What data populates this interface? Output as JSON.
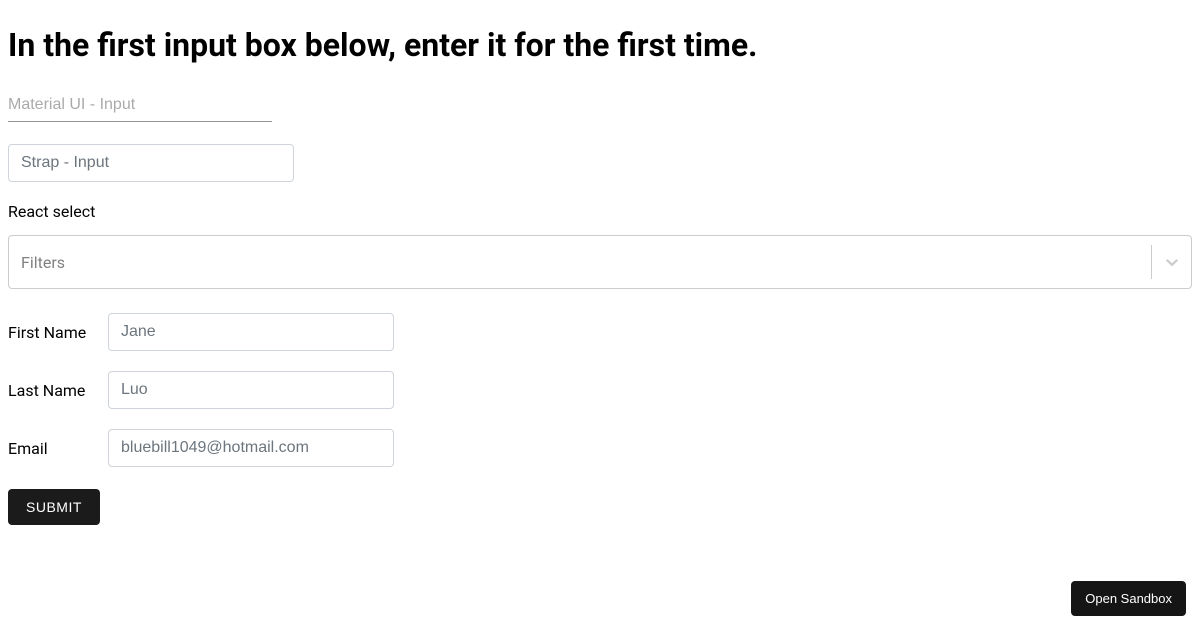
{
  "heading": "In the first input box below, enter it for the first time.",
  "inputs": {
    "mui_placeholder": "Material UI - Input",
    "strap_placeholder": "Strap - Input"
  },
  "react_select": {
    "label": "React select",
    "placeholder": "Filters"
  },
  "fields": {
    "first_name": {
      "label": "First Name",
      "placeholder": "Jane"
    },
    "last_name": {
      "label": "Last Name",
      "placeholder": "Luo"
    },
    "email": {
      "label": "Email",
      "placeholder": "bluebill1049@hotmail.com"
    }
  },
  "submit_label": "SUBMIT",
  "sandbox_label": "Open Sandbox"
}
